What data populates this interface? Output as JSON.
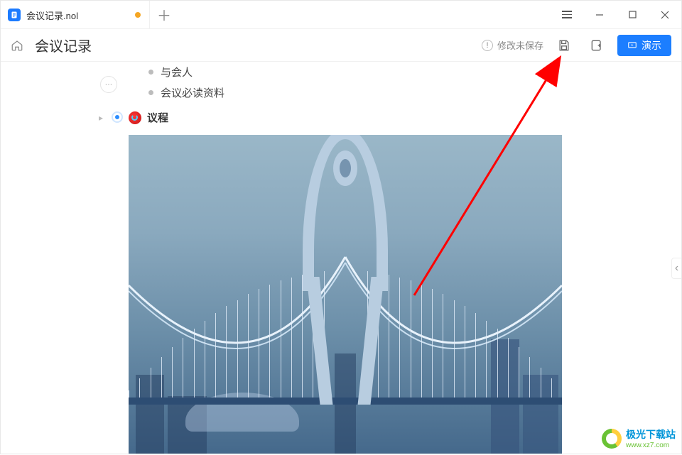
{
  "tab": {
    "title": "会议记录.nol",
    "unsaved": true
  },
  "toolbar": {
    "doc_title": "会议记录",
    "status": "修改未保存",
    "present_label": "演示"
  },
  "outline": {
    "bullets": [
      "与会人",
      "会议必读资料"
    ],
    "heading": "议程"
  },
  "watermark": {
    "cn": "极光下载站",
    "en": "www.xz7.com"
  },
  "annotation": {
    "arrow_target": "save-button"
  }
}
